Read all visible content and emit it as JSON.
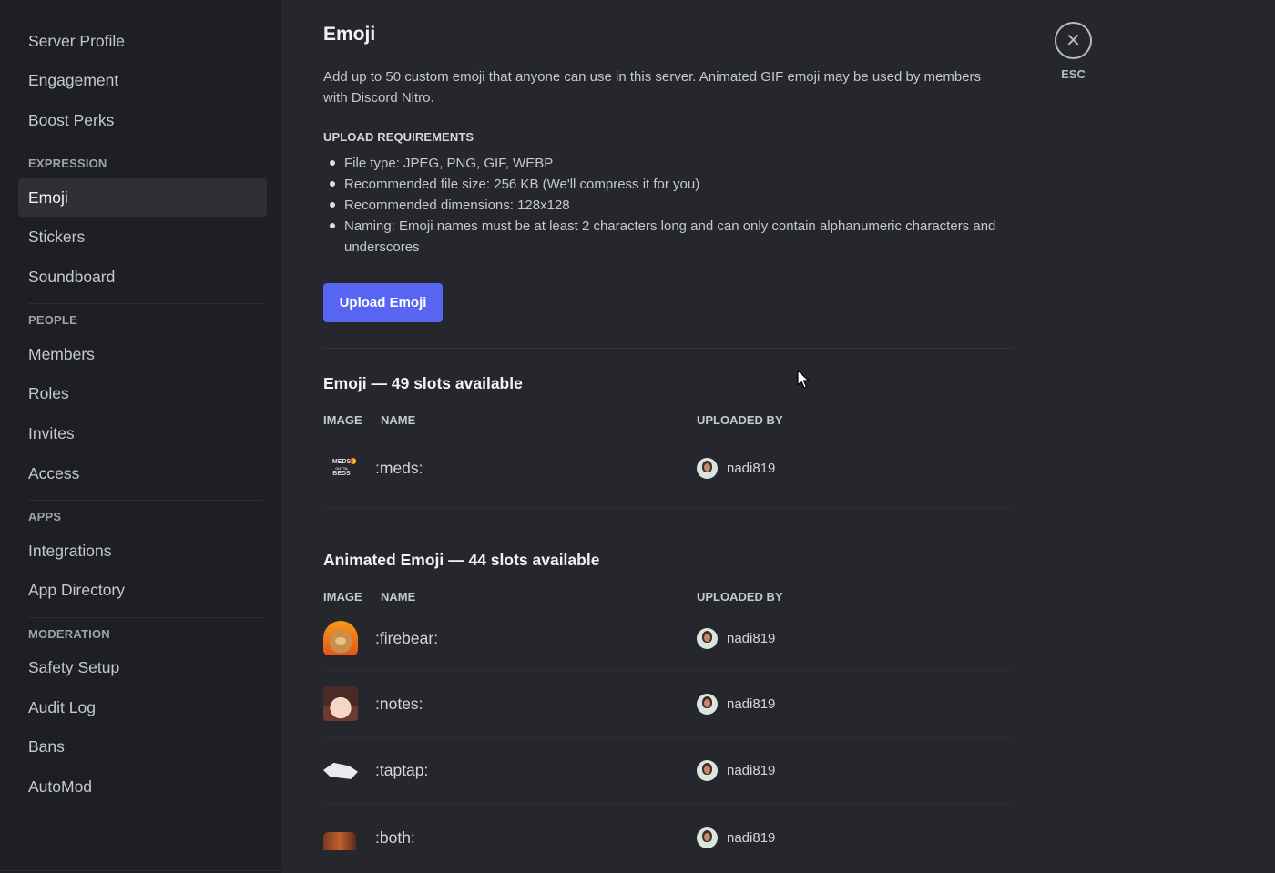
{
  "sidebar": {
    "top_items": [
      {
        "label": "Server Profile"
      },
      {
        "label": "Engagement"
      },
      {
        "label": "Boost Perks"
      }
    ],
    "sections": [
      {
        "header": "EXPRESSION",
        "items": [
          {
            "label": "Emoji",
            "active": true
          },
          {
            "label": "Stickers"
          },
          {
            "label": "Soundboard"
          }
        ]
      },
      {
        "header": "PEOPLE",
        "items": [
          {
            "label": "Members"
          },
          {
            "label": "Roles"
          },
          {
            "label": "Invites"
          },
          {
            "label": "Access"
          }
        ]
      },
      {
        "header": "APPS",
        "items": [
          {
            "label": "Integrations"
          },
          {
            "label": "App Directory"
          }
        ]
      },
      {
        "header": "MODERATION",
        "items": [
          {
            "label": "Safety Setup"
          },
          {
            "label": "Audit Log"
          },
          {
            "label": "Bans"
          },
          {
            "label": "AutoMod"
          }
        ]
      }
    ]
  },
  "main": {
    "title": "Emoji",
    "description": "Add up to 50 custom emoji that anyone can use in this server. Animated GIF emoji may be used by members with Discord Nitro.",
    "requirements_header": "UPLOAD REQUIREMENTS",
    "requirements": [
      "File type: JPEG, PNG, GIF, WEBP",
      "Recommended file size: 256 KB (We'll compress it for you)",
      "Recommended dimensions: 128x128",
      "Naming: Emoji names must be at least 2 characters long and can only contain alphanumeric characters and underscores"
    ],
    "upload_button": "Upload Emoji",
    "columns": {
      "image": "IMAGE",
      "name": "NAME",
      "uploaded_by": "UPLOADED BY"
    },
    "emoji_section": {
      "title": "Emoji — 49 slots available",
      "rows": [
        {
          "image_icon": "meds-emoji-icon",
          "image_text_top": "MEDS",
          "image_text_mid": "OUTTA",
          "image_text_bottom": "BEDS",
          "name": ":meds:",
          "uploader": "nadi819"
        }
      ]
    },
    "animated_section": {
      "title": "Animated Emoji — 44 slots available",
      "rows": [
        {
          "image_icon": "firebear-emoji-icon",
          "name": ":firebear:",
          "uploader": "nadi819"
        },
        {
          "image_icon": "notes-emoji-icon",
          "name": ":notes:",
          "uploader": "nadi819"
        },
        {
          "image_icon": "taptap-emoji-icon",
          "name": ":taptap:",
          "uploader": "nadi819"
        },
        {
          "image_icon": "both-emoji-icon",
          "name": ":both:",
          "uploader": "nadi819"
        }
      ]
    }
  },
  "close": {
    "icon": "close-icon",
    "glyph": "✕",
    "label": "ESC"
  },
  "colors": {
    "accent": "#5865f2",
    "sidebar_bg": "#1e1f22",
    "content_bg": "#25272c"
  }
}
